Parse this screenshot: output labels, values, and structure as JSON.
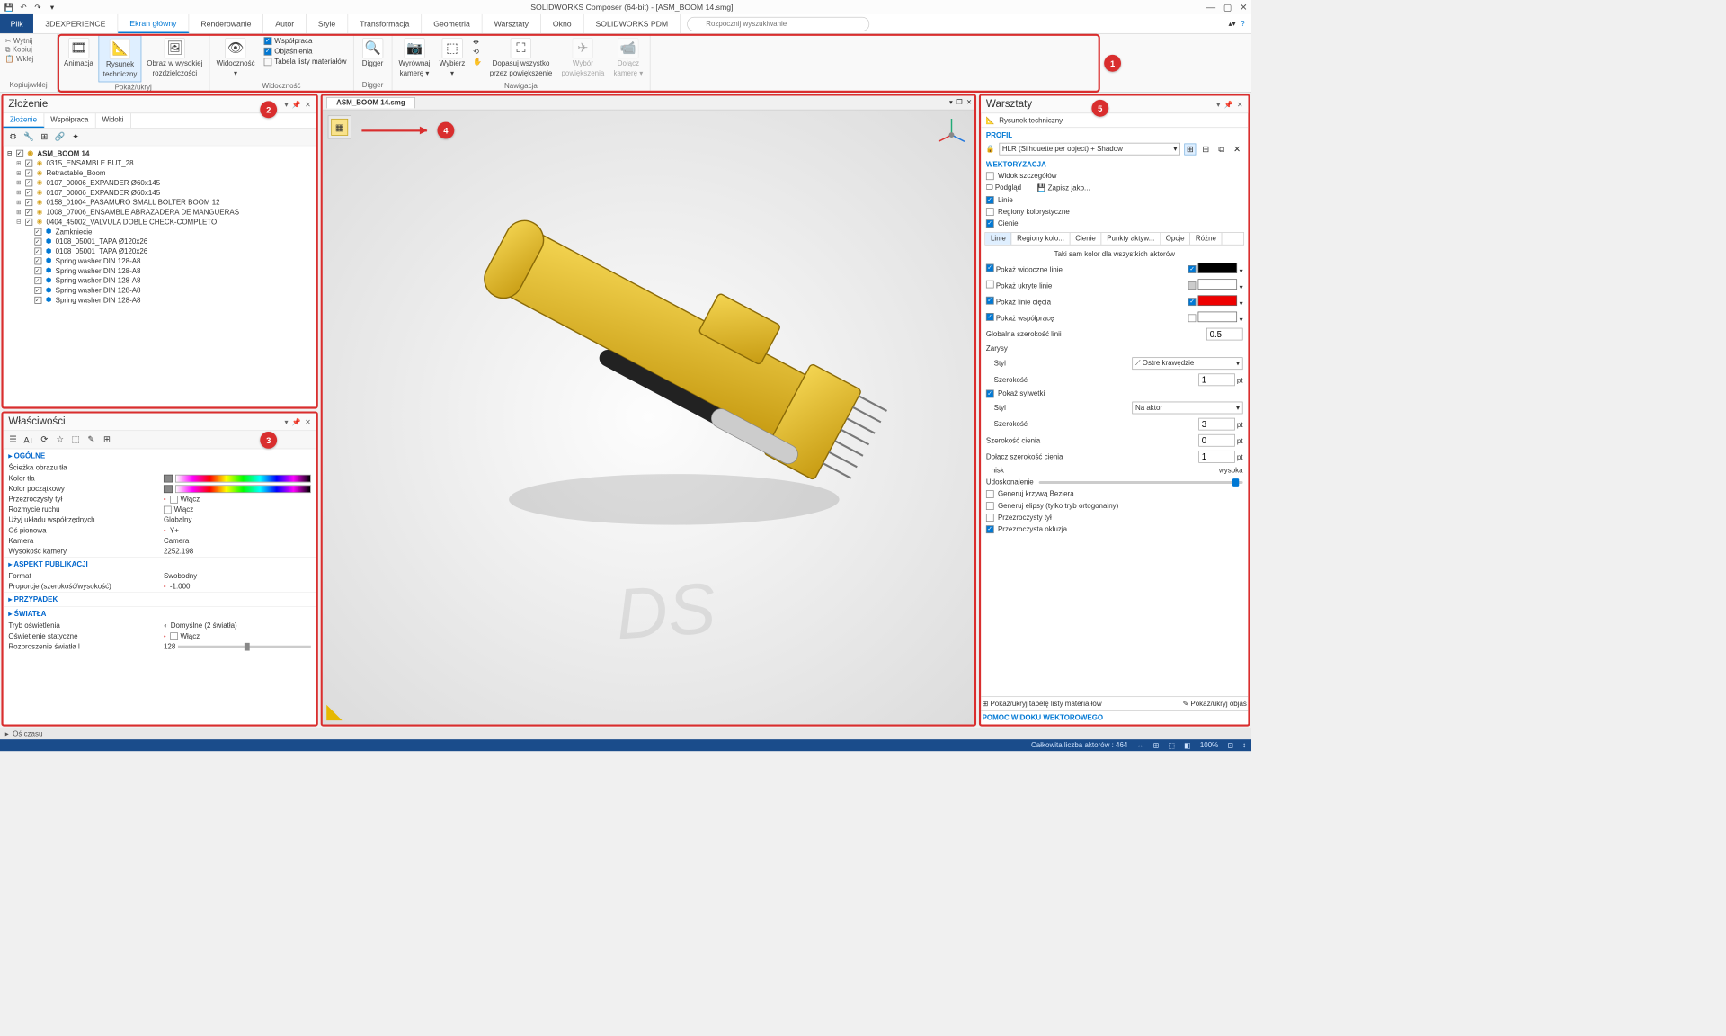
{
  "titlebar": {
    "title": "SOLIDWORKS Composer (64-bit) - [ASM_BOOM 14.smg]"
  },
  "menu": {
    "file": "Plik",
    "tabs": [
      "3DEXPERIENCE",
      "Ekran główny",
      "Renderowanie",
      "Autor",
      "Style",
      "Transformacja",
      "Geometria",
      "Warsztaty",
      "Okno",
      "SOLIDWORKS PDM"
    ],
    "activeIndex": 1,
    "searchPlaceholder": "Rozpocznij wyszukiwanie"
  },
  "ribbon": {
    "clipboard": {
      "cut": "Wytnij",
      "copy": "Kopiuj",
      "paste": "Wklej",
      "label": "Kopiuj/wklej"
    },
    "showhide": {
      "anim": "Animacja",
      "tech1": "Rysunek",
      "tech2": "techniczny",
      "hires1": "Obraz w wysokiej",
      "hires2": "rozdzielczości",
      "label": "Pokaż/ukryj"
    },
    "visibility": {
      "vis": "Widoczność",
      "collab": "Współpraca",
      "explain": "Objaśnienia",
      "bom": "Tabela listy materiałów",
      "label": "Widoczność"
    },
    "digger": {
      "btn": "Digger",
      "label": "Digger"
    },
    "nav": {
      "align1": "Wyrównaj",
      "align2": "kamerę",
      "select": "Wybierz",
      "fit1": "Dopasuj wszystko",
      "fit2": "przez powiększenie",
      "zoomsel1": "Wybór",
      "zoomsel2": "powiększenia",
      "attach1": "Dołącz",
      "attach2": "kamerę",
      "label": "Nawigacja"
    }
  },
  "assembly": {
    "title": "Złożenie",
    "tabs": [
      "Złożenie",
      "Współpraca",
      "Widoki"
    ],
    "root": "ASM_BOOM 14",
    "items": [
      {
        "t": "0315_ENSAMBLE BUT_28",
        "i": "asm"
      },
      {
        "t": "Retractable_Boom",
        "i": "asm"
      },
      {
        "t": "0107_00006_EXPANDER Ø60x145",
        "i": "asm"
      },
      {
        "t": "0107_00006_EXPANDER Ø60x145",
        "i": "asm"
      },
      {
        "t": "0158_01004_PASAMURO SMALL BOLTER BOOM 12",
        "i": "asm"
      },
      {
        "t": "1008_07006_ENSAMBLE ABRAZADERA DE MANGUERAS",
        "i": "asm"
      },
      {
        "t": "0404_45002_VALVULA DOBLE CHECK-COMPLETO",
        "i": "asm"
      }
    ],
    "subitems": [
      {
        "t": "Zamkniecie",
        "i": "part"
      },
      {
        "t": "0108_05001_TAPA Ø120x26",
        "i": "part"
      },
      {
        "t": "0108_05001_TAPA Ø120x26",
        "i": "part"
      },
      {
        "t": "Spring washer DIN 128-A8",
        "i": "part"
      },
      {
        "t": "Spring washer DIN 128-A8",
        "i": "part"
      },
      {
        "t": "Spring washer DIN 128-A8",
        "i": "part"
      },
      {
        "t": "Spring washer DIN 128-A8",
        "i": "part"
      },
      {
        "t": "Spring washer DIN 128-A8",
        "i": "part"
      }
    ]
  },
  "properties": {
    "title": "Właściwości",
    "sections": {
      "general": "OGÓLNE",
      "publish": "ASPEKT PUBLIKACJI",
      "case": "PRZYPADEK",
      "lights": "ŚWIATŁA"
    },
    "rows": {
      "bgpath": {
        "l": "Ścieżka obrazu tła",
        "v": ""
      },
      "bgcolor": {
        "l": "Kolor tła",
        "v": ""
      },
      "startcolor": {
        "l": "Kolor początkowy",
        "v": ""
      },
      "transback": {
        "l": "Przezroczysty tył",
        "v": "Włącz"
      },
      "motionblur": {
        "l": "Rozmycie ruchu",
        "v": "Włącz"
      },
      "coord": {
        "l": "Użyj układu współrzędnych",
        "v": "Globalny"
      },
      "vert": {
        "l": "Oś pionowa",
        "v": "Y+"
      },
      "camera": {
        "l": "Kamera",
        "v": "Camera"
      },
      "camheight": {
        "l": "Wysokość kamery",
        "v": "2252.198"
      },
      "format": {
        "l": "Format",
        "v": "Swobodny"
      },
      "ratio": {
        "l": "Proporcje (szerokość/wysokość)",
        "v": "-1.000"
      },
      "lightmode": {
        "l": "Tryb oświetlenia",
        "v": "Domyślne (2 światła)"
      },
      "staticlight": {
        "l": "Oświetlenie statyczne",
        "v": "Włącz"
      },
      "diffusion": {
        "l": "Rozproszenie światła l",
        "v": "128"
      }
    }
  },
  "viewport": {
    "tab": "ASM_BOOM 14.smg"
  },
  "workshop": {
    "title": "Warsztaty",
    "subtitle": "Rysunek techniczny",
    "sections": {
      "profile": "PROFIL",
      "vector": "WEKTORYZACJA"
    },
    "profileCombo": "HLR (Silhouette per object) + Shadow",
    "detailView": "Widok szczegółów",
    "preview": "Podgląd",
    "saveas": "Zapisz jako...",
    "cb": {
      "lines": "Linie",
      "regions": "Regiony kolorystyczne",
      "shadows": "Cienie"
    },
    "tabs": [
      "Linie",
      "Regiony kolo...",
      "Cienie",
      "Punkty aktyw...",
      "Opcje",
      "Różne"
    ],
    "sameColor": "Taki sam kolor dla wszystkich aktorów",
    "visLines": "Pokaż widoczne linie",
    "hidLines": "Pokaż ukryte linie",
    "cutLines": "Pokaż linie cięcia",
    "collab": "Pokaż współpracę",
    "globalW": {
      "l": "Globalna szerokość linii",
      "v": "0.5"
    },
    "outlines": "Zarysy",
    "style": {
      "l": "Styl",
      "v": "Ostre krawędzie"
    },
    "width": {
      "l": "Szerokość",
      "v": "1",
      "u": "pt"
    },
    "silh": "Pokaż sylwetki",
    "style2": {
      "l": "Styl",
      "v": "Na aktor"
    },
    "width2": {
      "l": "Szerokość",
      "v": "3",
      "u": "pt"
    },
    "shadowW": {
      "l": "Szerokość cienia",
      "v": "0",
      "u": "pt"
    },
    "attachShadow": {
      "l": "Dołącz szerokość cienia",
      "v": "1",
      "u": "pt"
    },
    "refine": {
      "l": "Udoskonalenie",
      "low": "nisk",
      "high": "wysoka"
    },
    "bezier": "Generuj krzywą Beziera",
    "ellipse": "Generuj elipsy (tylko tryb ortogonalny)",
    "transBack": "Przezroczysty tył",
    "transOcc": "Przezroczysta okluzja",
    "footer": {
      "bom": "Pokaż/ukryj tabelę listy materia łów",
      "explain": "Pokaż/ukryj objaś"
    },
    "help": "POMOC WIDOKU WEKTOROWEGO"
  },
  "timeline": {
    "label": "Oś czasu"
  },
  "status": {
    "actors": "Całkowita liczba aktorów : 464",
    "zoom": "100%"
  }
}
